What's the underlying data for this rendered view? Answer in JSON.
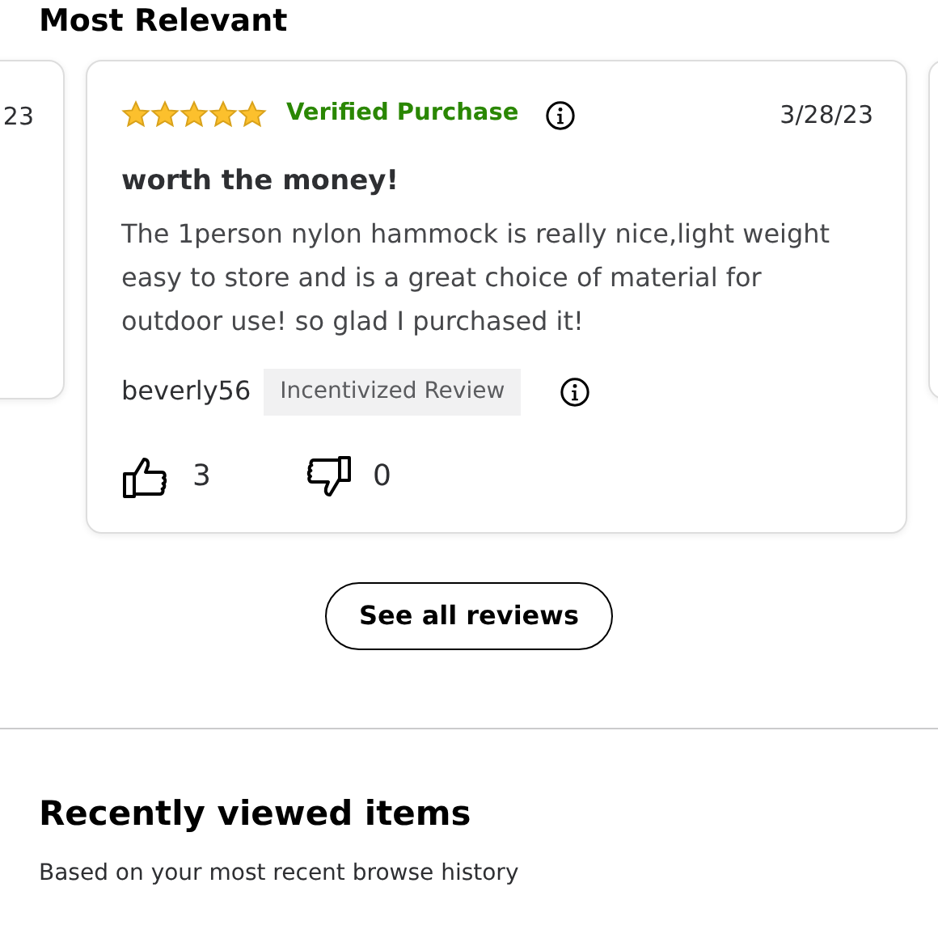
{
  "section_title": "Most Relevant",
  "reviews": [
    {
      "kind": "partial",
      "date": "23"
    },
    {
      "kind": "full",
      "stars": 5,
      "verified": "Verified Purchase",
      "date": "3/28/23",
      "title": "worth the money!",
      "body": "The 1person nylon hammock is really nice,light weight easy to store and is a great choice of material for outdoor use! so glad I purchased it!",
      "author": "beverly56",
      "tag": "Incentivized Review",
      "helpful": "3",
      "unhelpful": "0"
    }
  ],
  "see_all": "See all reviews",
  "recent": {
    "title": "Recently viewed items",
    "subtitle": "Based on your most recent browse history"
  }
}
